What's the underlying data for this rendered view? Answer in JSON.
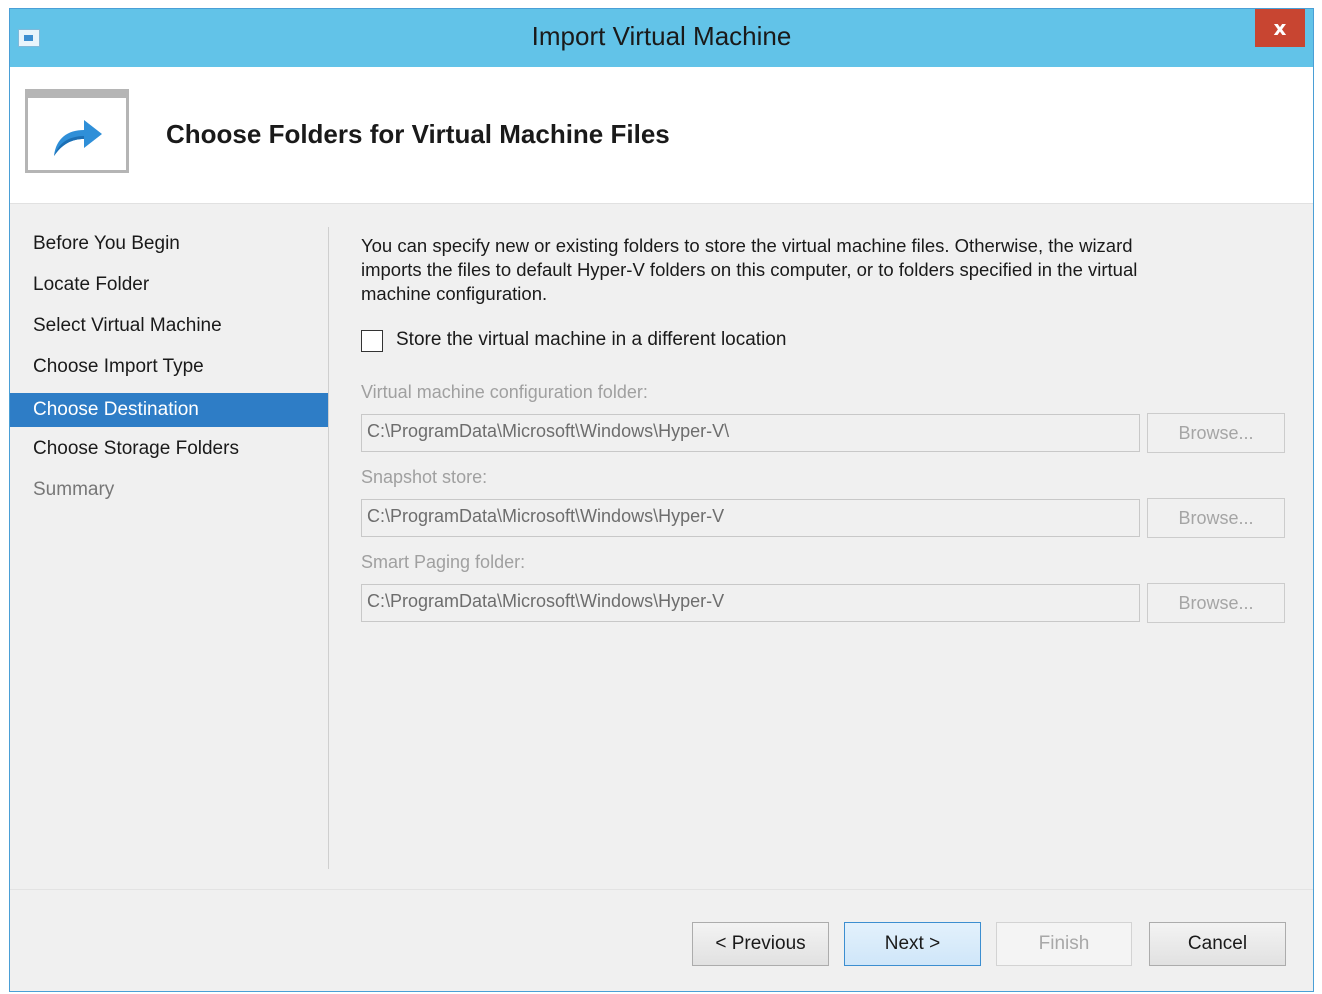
{
  "window": {
    "title": "Import Virtual Machine",
    "close_label": "x",
    "app_icon": "hyper-v-window-icon"
  },
  "header": {
    "title": "Choose Folders for Virtual Machine Files",
    "icon": "import-arrow-icon"
  },
  "nav": {
    "items": [
      {
        "label": "Before You Begin",
        "state": "normal"
      },
      {
        "label": "Locate Folder",
        "state": "normal"
      },
      {
        "label": "Select Virtual Machine",
        "state": "normal"
      },
      {
        "label": "Choose Import Type",
        "state": "normal"
      },
      {
        "label": "Choose Destination",
        "state": "selected"
      },
      {
        "label": "Choose Storage Folders",
        "state": "normal"
      },
      {
        "label": "Summary",
        "state": "disabled"
      }
    ]
  },
  "content": {
    "description_lines": [
      "You can specify new or existing folders to store the virtual machine files. Otherwise, the wizard",
      "imports the files to default Hyper-V folders on this computer, or to folders specified in the virtual",
      "machine configuration."
    ],
    "store_checkbox": {
      "label": "Store the virtual machine in a different location",
      "checked": false
    },
    "fields": [
      {
        "label": "Virtual machine configuration folder:",
        "value": "C:\\ProgramData\\Microsoft\\Windows\\Hyper-V\\",
        "browse_label": "Browse...",
        "enabled": false
      },
      {
        "label": "Snapshot store:",
        "value": "C:\\ProgramData\\Microsoft\\Windows\\Hyper-V",
        "browse_label": "Browse...",
        "enabled": false
      },
      {
        "label": "Smart Paging folder:",
        "value": "C:\\ProgramData\\Microsoft\\Windows\\Hyper-V",
        "browse_label": "Browse...",
        "enabled": false
      }
    ]
  },
  "buttons": {
    "previous": "< Previous",
    "next": "Next >",
    "finish": "Finish",
    "cancel": "Cancel"
  },
  "colors": {
    "titlebar": "#62c3e8",
    "close_button": "#c84531",
    "nav_selected": "#2e7dc6",
    "primary_button_border": "#3c8ed0"
  }
}
